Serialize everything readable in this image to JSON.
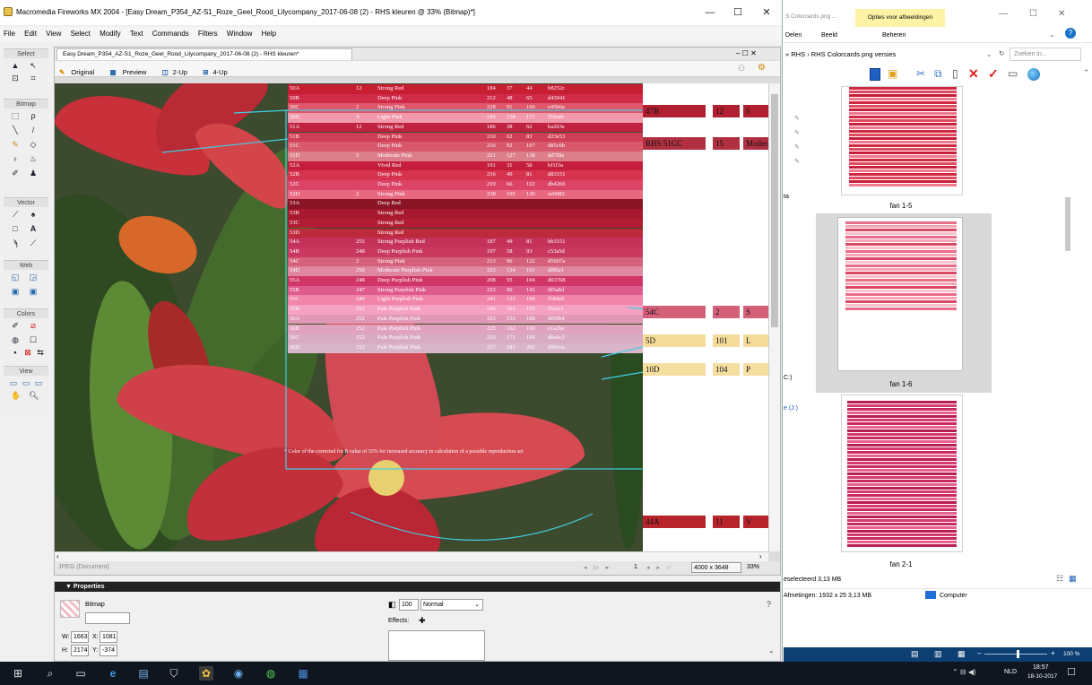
{
  "fireworks": {
    "title": "Macromedia Fireworks MX 2004 - [Easy Dream_P354_AZ-S1_Roze_Geel_Rood_Lilycompany_2017-06-08 (2) - RHS kleuren @ 33% (Bitmap)*]",
    "min": "—",
    "max": "☐",
    "close": "✕",
    "menu": [
      "File",
      "Edit",
      "View",
      "Select",
      "Modify",
      "Text",
      "Commands",
      "Filters",
      "Window",
      "Help"
    ],
    "tool_sections": [
      "Select",
      "Bitmap",
      "Vector",
      "Web",
      "Colors",
      "View"
    ],
    "doc_tab": "Easy Dream_P354_AZ-S1_Roze_Geel_Rood_Lilycompany_2017-06-08 (2) - RHS kleuren*",
    "doc_ctrl": "– ☐ ✕",
    "views": [
      "Original",
      "Preview",
      "2-Up",
      "4-Up"
    ],
    "status_left": "JPEG (Document)",
    "status_size": "4000 x 3648",
    "status_zoom": "33%",
    "status_page": "1",
    "props_title": "▼ Properties",
    "props_type": "Bitmap",
    "props_w_label": "W:",
    "props_w": "1663",
    "props_x_label": "X:",
    "props_x": "1081",
    "props_h_label": "H:",
    "props_h": "2174",
    "props_y_label": "Y:",
    "props_y": "-374",
    "props_opacity": "100",
    "props_blend": "Normal",
    "props_effects": "Effects:"
  },
  "rhs_table": [
    {
      "code": "50A",
      "num": "12",
      "name": "Strong Red",
      "r": "184",
      "g": "37",
      "b": "44",
      "hex": "b8252c",
      "color": "#c81e32"
    },
    {
      "code": "50B",
      "num": "",
      "name": "Deep Pink",
      "r": "212",
      "g": "48",
      "b": "65",
      "hex": "d43041",
      "color": "#cf2a48"
    },
    {
      "code": "50C",
      "num": "2",
      "name": "Strong Pink",
      "r": "228",
      "g": "91",
      "b": "106",
      "hex": "e45b6a",
      "color": "#e0566a"
    },
    {
      "code": "50D",
      "num": "4",
      "name": "Light Pink",
      "r": "245",
      "g": "158",
      "b": "171",
      "hex": "f59eab",
      "color": "#f09aab"
    },
    {
      "code": "51A",
      "num": "12",
      "name": "Strong Red",
      "r": "186",
      "g": "38",
      "b": "62",
      "hex": "ba263e",
      "color": "#c02340"
    },
    {
      "code": "51B",
      "num": "",
      "name": "Deep Pink",
      "r": "210",
      "g": "62",
      "b": "83",
      "hex": "d23e53",
      "color": "#d03e55"
    },
    {
      "code": "51C",
      "num": "",
      "name": "Deep Pink",
      "r": "216",
      "g": "92",
      "b": "107",
      "hex": "d85c6b",
      "color": "#d8596b"
    },
    {
      "code": "51D",
      "num": "5",
      "name": "Moderate Pink",
      "r": "221",
      "g": "127",
      "b": "138",
      "hex": "dd7f8a",
      "color": "#dd7f8a"
    },
    {
      "code": "52A",
      "num": "",
      "name": "Vivid Red",
      "r": "191",
      "g": "31",
      "b": "58",
      "hex": "bf1f3a",
      "color": "#c41e3c"
    },
    {
      "code": "52B",
      "num": "",
      "name": "Deep Pink",
      "r": "216",
      "g": "49",
      "b": "81",
      "hex": "d83151",
      "color": "#d6334f"
    },
    {
      "code": "52C",
      "num": "",
      "name": "Deep Pink",
      "r": "219",
      "g": "66",
      "b": "102",
      "hex": "db4266",
      "color": "#db4466"
    },
    {
      "code": "52D",
      "num": "2",
      "name": "Strong Pink",
      "r": "238",
      "g": "105",
      "b": "130",
      "hex": "ee6982",
      "color": "#e86880"
    },
    {
      "code": "53A",
      "num": "",
      "name": "Deep Red",
      "r": "",
      "g": "",
      "b": "",
      "hex": "",
      "color": "#8a1426"
    },
    {
      "code": "53B",
      "num": "",
      "name": "Strong Red",
      "r": "",
      "g": "",
      "b": "",
      "hex": "",
      "color": "#a8182e"
    },
    {
      "code": "53C",
      "num": "",
      "name": "Strong Red",
      "r": "",
      "g": "",
      "b": "",
      "hex": "",
      "color": "#b21c34"
    },
    {
      "code": "53D",
      "num": "",
      "name": "Strong Red",
      "r": "",
      "g": "",
      "b": "",
      "hex": "",
      "color": "#bc2a3c"
    },
    {
      "code": "54A",
      "num": "255",
      "name": "Strong Purplish Red",
      "r": "187",
      "g": "49",
      "b": "81",
      "hex": "bb3151",
      "color": "#c4325a"
    },
    {
      "code": "54B",
      "num": "248",
      "name": "Deep Purplish Pink",
      "r": "197",
      "g": "58",
      "b": "93",
      "hex": "c53a5d",
      "color": "#c9395f"
    },
    {
      "code": "54C",
      "num": "2",
      "name": "Strong Pink",
      "r": "213",
      "g": "96",
      "b": "122",
      "hex": "d5607a",
      "color": "#d5607a"
    },
    {
      "code": "54D",
      "num": "250",
      "name": "Moderate Purplish Pink",
      "r": "223",
      "g": "134",
      "b": "161",
      "hex": "df86a1",
      "color": "#df86a1"
    },
    {
      "code": "55A",
      "num": "248",
      "name": "Deep Purplish Pink",
      "r": "208",
      "g": "55",
      "b": "104",
      "hex": "d03768",
      "color": "#d03768"
    },
    {
      "code": "55B",
      "num": "247",
      "name": "Strong Purplish Pink",
      "r": "223",
      "g": "90",
      "b": "141",
      "hex": "df5a8d",
      "color": "#df5a8d"
    },
    {
      "code": "55C",
      "num": "249",
      "name": "Light Purplish Pink",
      "r": "241",
      "g": "132",
      "b": "169",
      "hex": "f184a9",
      "color": "#f184a9"
    },
    {
      "code": "55D",
      "num": "252",
      "name": "Pale Purplish Pink",
      "r": "245",
      "g": "161",
      "b": "193",
      "hex": "f5a1c1",
      "color": "#f5a1c1"
    },
    {
      "code": "56A",
      "num": "252",
      "name": "Pale Purplish Pink",
      "r": "223",
      "g": "153",
      "b": "180",
      "hex": "df99b4",
      "color": "#df99b4"
    },
    {
      "code": "56B",
      "num": "252",
      "name": "Pale Purplish Pink",
      "r": "225",
      "g": "162",
      "b": "190",
      "hex": "e1a2be",
      "color": "#e1a2be"
    },
    {
      "code": "56C",
      "num": "252",
      "name": "Pale Purplish Pink",
      "r": "216",
      "g": "171",
      "b": "194",
      "hex": "d8abc2",
      "color": "#d8abc2"
    },
    {
      "code": "56D",
      "num": "252",
      "name": "Pale Purplish Pink",
      "r": "217",
      "g": "181",
      "b": "202",
      "hex": "d9b5ca",
      "color": "#d9b5ca"
    }
  ],
  "rhs_note": "* Color of the corrected for B value of 55% for increased accuracy in calculation of a possible reproduction set",
  "right_strip": [
    {
      "code": "47B",
      "val": "12",
      "extra": "S",
      "color": "#b02030"
    },
    {
      "code": "RHS 51GC",
      "val": "15",
      "extra": "Moderate Re",
      "color": "#b03040"
    },
    {
      "code": "54C",
      "val": "2",
      "extra": "S",
      "color": "#d5607a"
    },
    {
      "code": "5D",
      "val": "101",
      "extra": "L",
      "color": "#f5dc9a"
    },
    {
      "code": "10D",
      "val": "104",
      "extra": "P",
      "color": "#f5dfa0"
    },
    {
      "code": "44A",
      "val": "11",
      "extra": "V",
      "color": "#b8242c"
    }
  ],
  "explorer": {
    "tab_left": "S Colorcards png ...",
    "tab_context": "Opties voor afbeeldingen",
    "ribbon": [
      "Delen",
      "Beeld",
      "Beheren"
    ],
    "path_sep": "«",
    "path": [
      "RHS",
      "RHS Colorcards png versies"
    ],
    "search_placeholder": "Zoeken in...",
    "left_labels": [
      "ta",
      "C:)",
      "e (J:)"
    ],
    "files": [
      "fan 1-5",
      "fan 1-6",
      "fan 2-1"
    ],
    "status_selected": "eselecteerd 3,13 MB",
    "status_dims": "Afmetingen: 1932 x 25  3,13 MB",
    "status_computer": "Computer",
    "zoom": "100 %"
  },
  "taskbar": {
    "lang": "NLD",
    "time": "18:57",
    "date": "18-10-2017"
  }
}
